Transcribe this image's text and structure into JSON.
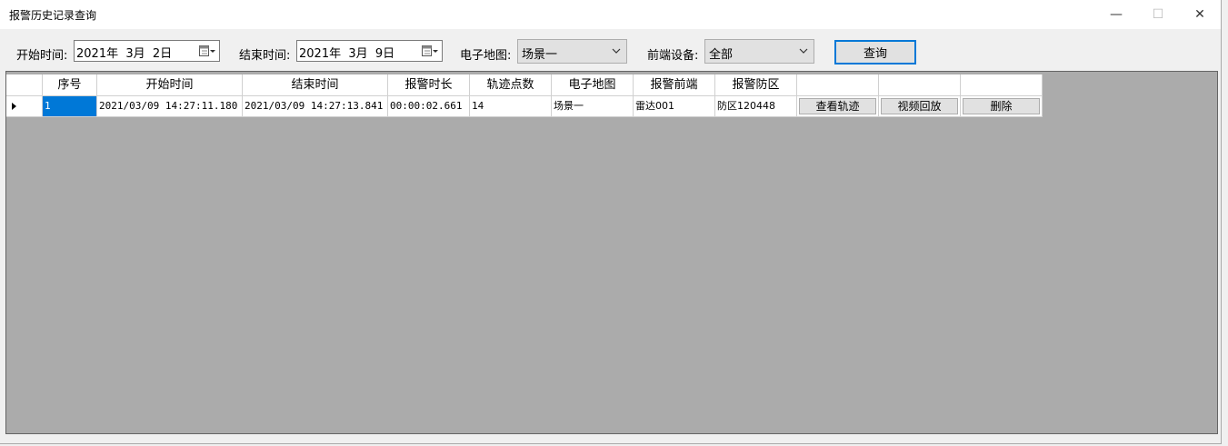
{
  "window": {
    "title": "报警历史记录查询",
    "minimize_glyph": "—",
    "maximize_glyph": "☐",
    "close_glyph": "✕"
  },
  "filters": {
    "start_label": "开始时间:",
    "start_value": "2021年  3月  2日",
    "end_label": "结束时间:",
    "end_value": "2021年  3月  9日",
    "map_label": "电子地图:",
    "map_value": "场景一",
    "device_label": "前端设备:",
    "device_value": "全部",
    "query_button": "查询"
  },
  "table": {
    "columns": [
      "序号",
      "开始时间",
      "结束时间",
      "报警时长",
      "轨迹点数",
      "电子地图",
      "报警前端",
      "报警防区",
      "",
      "",
      ""
    ],
    "rows": [
      {
        "index": "1",
        "start": "2021/03/09 14:27:11.180",
        "end": "2021/03/09 14:27:13.841",
        "duration": "00:00:02.661",
        "points": "14",
        "map": "场景一",
        "device": "雷达001",
        "zone": "防区120448",
        "btn_track": "查看轨迹",
        "btn_video": "视频回放",
        "btn_delete": "删除"
      }
    ]
  },
  "colors": {
    "selection": "#0078d7",
    "grid_background": "#ababab",
    "window_background": "#f0f0f0"
  }
}
